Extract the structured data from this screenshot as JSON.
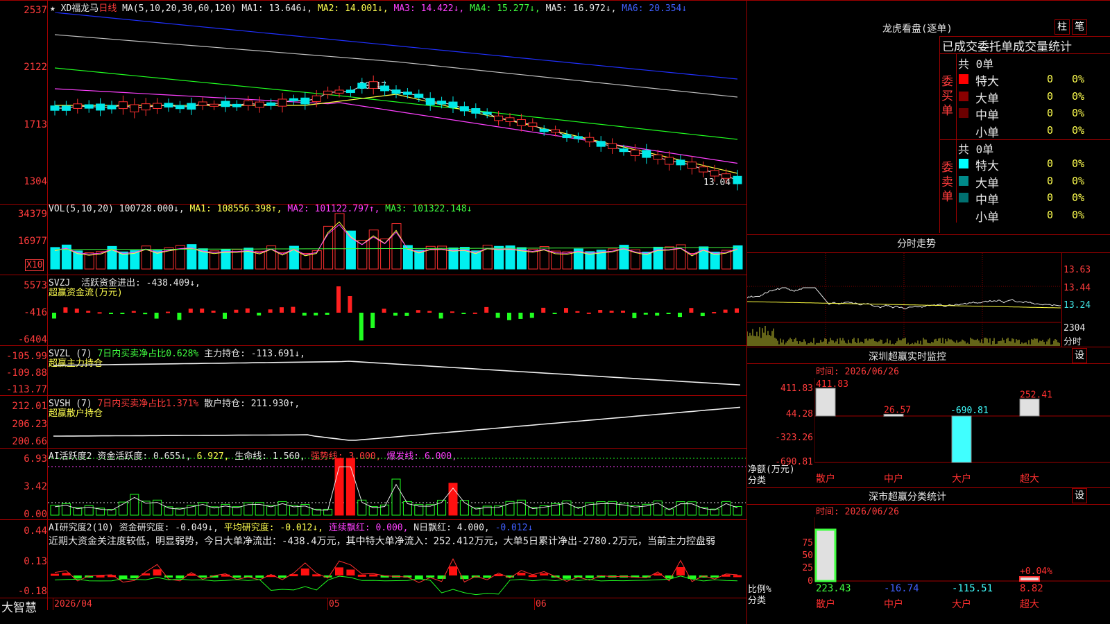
{
  "price_panel": {
    "star": "★",
    "stock_name": "XD福龙马",
    "period": "日线",
    "ma_params": "MA(5,10,20,30,60,120)",
    "ma1": "MA1: 13.646↓,",
    "ma2": "MA2: 14.001↓,",
    "ma3": "MA3: 14.422↓,",
    "ma4": "MA4: 15.277↓,",
    "ma5": "MA5: 16.972↓,",
    "ma6": "MA6: 20.354↓",
    "axis": [
      "2537",
      "2122",
      "1713",
      "1304"
    ],
    "high_mark": "20.17",
    "low_mark": "13.04"
  },
  "vol_panel": {
    "label": "VOL(5,10,20)",
    "value": "100728.000↓,",
    "ma1": "MA1: 108556.398↑,",
    "ma2": "MA2: 101122.797↑,",
    "ma3": "MA3: 101322.148↓",
    "axis": [
      "34379",
      "16977"
    ],
    "unit": "X10"
  },
  "svzj_panel": {
    "label": "SVZJ",
    "line1": "活跃资金进出: -438.409↓,",
    "line2": "超赢资金流(万元)",
    "axis": [
      "5573",
      "-416",
      "-6404"
    ]
  },
  "svzl_panel": {
    "label": "SVZL (7)",
    "ratio": "7日内买卖净占比0.628%",
    "hold": "主力持仓: -113.691↓,",
    "line2": "超赢主力持仓",
    "axis": [
      "-105.99",
      "-109.88",
      "-113.77"
    ]
  },
  "svsh_panel": {
    "label": "SVSH (7)",
    "ratio": "7日内买卖净占比1.371%",
    "hold": "散户持仓: 211.930↑,",
    "line2": "超赢散户持仓",
    "axis": [
      "212.01",
      "206.23",
      "200.66"
    ]
  },
  "ai_active_panel": {
    "label": "AI活跃度2",
    "v1": "资金活跃度: 0.655↓,",
    "v2": "6.927,",
    "v3": "生命线: 1.560,",
    "v4": "强势线: 3.000,",
    "v5": "爆发线: 6.000,",
    "axis": [
      "6.93",
      "3.42",
      "0.00"
    ]
  },
  "ai_research_panel": {
    "label": "AI研究度2(10)",
    "v1": "资金研究度: -0.049↓,",
    "v2": "平均研究度: -0.012↓,",
    "v3": "连续飘红: 0.000,",
    "v4": "N日飘红: 4.000,",
    "v5": "-0.012↓",
    "comment": "近期大资金关注度较低，明显弱势，今日大单净流出：-438.4万元，其中特大单净流入：252.412万元，大单5日累计净出-2780.2万元，当前主力控盘弱",
    "axis": [
      "0.44",
      "0.13",
      "-0.18"
    ]
  },
  "bottom_bar": {
    "brand": "大智慧",
    "dates": [
      "2026/04",
      "05",
      "06"
    ]
  },
  "longhu": {
    "title": "龙虎看盘(逐单)",
    "btn1": "柱",
    "btn2": "笔",
    "header": "已成交委托单成交量统计",
    "buy_label": "委买单",
    "sell_label": "委卖单",
    "buy_total": "共 0单",
    "sell_total": "共 0单",
    "buy_rows": [
      {
        "name": "特大",
        "count": "0",
        "pct": "0%",
        "color": "#ff0000"
      },
      {
        "name": "大单",
        "count": "0",
        "pct": "0%",
        "color": "#8b0000"
      },
      {
        "name": "中单",
        "count": "0",
        "pct": "0%",
        "color": "#6b0000"
      },
      {
        "name": "小单",
        "count": "0",
        "pct": "0%",
        "color": ""
      }
    ],
    "sell_rows": [
      {
        "name": "特大",
        "count": "0",
        "pct": "0%",
        "color": "#00ffff"
      },
      {
        "name": "大单",
        "count": "0",
        "pct": "0%",
        "color": "#008b8b"
      },
      {
        "name": "中单",
        "count": "0",
        "pct": "0%",
        "color": "#007070"
      },
      {
        "name": "小单",
        "count": "0",
        "pct": "0%",
        "color": ""
      }
    ]
  },
  "intraday": {
    "title": "分时走势",
    "axis": [
      "13.63",
      "13.44",
      "13.24"
    ],
    "vol": "2304",
    "unit": "分时"
  },
  "sz_monitor": {
    "title": "深圳超赢实时监控",
    "set": "设",
    "time": "时间: 2026/06/26",
    "axis": [
      "411.83",
      "44.28",
      "-323.26",
      "-690.81"
    ],
    "ylabel": "净额(万元)",
    "xlabel": "分类",
    "categories": [
      "散户",
      "中户",
      "大户",
      "超大"
    ],
    "values": [
      411.83,
      26.57,
      -690.81,
      252.41
    ],
    "value_labels": [
      "411.83",
      "26.57",
      "-690.81",
      "252.41"
    ]
  },
  "sz_class": {
    "title": "深市超赢分类统计",
    "set": "设",
    "time": "时间: 2026/06/26",
    "axis": [
      "75",
      "50",
      "25",
      "0"
    ],
    "ylabel": "比例%",
    "xlabel": "分类",
    "categories": [
      "散户",
      "中户",
      "大户",
      "超大"
    ],
    "values": [
      "223.43",
      "-16.74",
      "-115.51",
      "8.82"
    ],
    "extra": "+0.04%"
  },
  "chart_data": {
    "type": "bar",
    "title": "深圳超赢实时监控",
    "categories": [
      "散户",
      "中户",
      "大户",
      "超大"
    ],
    "values": [
      411.83,
      26.57,
      -690.81,
      252.41
    ],
    "ylabel": "净额(万元)",
    "ylim": [
      -690.81,
      411.83
    ]
  }
}
